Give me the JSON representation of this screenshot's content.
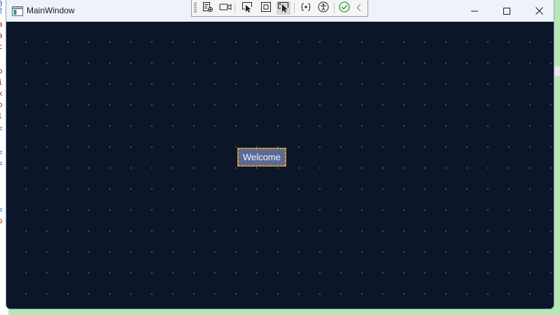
{
  "window": {
    "title": "MainWindow"
  },
  "caption_buttons": {
    "minimize_icon": "minimize-icon",
    "maximize_icon": "maximize-icon",
    "close_icon": "close-icon"
  },
  "debug_toolbar": {
    "buttons": [
      {
        "icon": "live-visual-tree-icon"
      },
      {
        "icon": "camera-icon"
      },
      {
        "icon": "select-element-icon"
      },
      {
        "icon": "display-layout-adorners-icon"
      },
      {
        "icon": "track-focused-element-icon"
      },
      {
        "icon": "binding-failures-icon"
      },
      {
        "icon": "accessibility-icon"
      },
      {
        "icon": "check-circle-icon"
      },
      {
        "icon": "collapse-chevron-icon"
      }
    ]
  },
  "content": {
    "welcome_button_label": "Welcome"
  },
  "colors": {
    "canvas_background": "#0b1628",
    "titlebar_background": "#eef3fa",
    "button_fill": "#5b6b95",
    "button_focus_border": "#e3a634",
    "check_green": "#2ea043"
  }
}
